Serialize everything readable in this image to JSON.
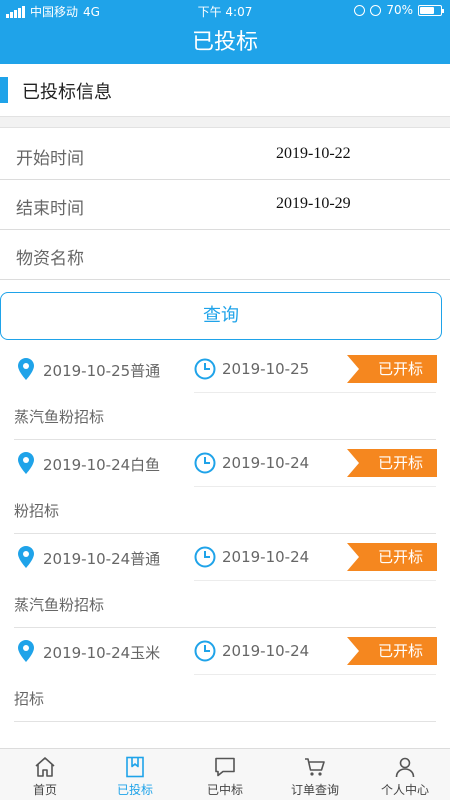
{
  "status_bar": {
    "carrier": "中国移动",
    "network": "4G",
    "time": "下午 4:07",
    "battery": "70%",
    "battery_level": 0.7
  },
  "nav": {
    "title": "已投标"
  },
  "section": {
    "title": "已投标信息"
  },
  "form": {
    "start_label": "开始时间",
    "start_value": "2019-10-22",
    "end_label": "结束时间",
    "end_value": "2019-10-29",
    "material_label": "物资名称",
    "material_value": ""
  },
  "query_button": "查询",
  "bids": [
    {
      "location": "2019-10-25普通",
      "time": "2019-10-25",
      "status": "已开标",
      "name": "蒸汽鱼粉招标"
    },
    {
      "location": "2019-10-24白鱼",
      "time": "2019-10-24",
      "status": "已开标",
      "name": "粉招标"
    },
    {
      "location": "2019-10-24普通",
      "time": "2019-10-24",
      "status": "已开标",
      "name": "蒸汽鱼粉招标"
    },
    {
      "location": "2019-10-24玉米",
      "time": "2019-10-24",
      "status": "已开标",
      "name": "招标"
    }
  ],
  "tabs": [
    {
      "label": "首页",
      "icon": "home-icon",
      "active": false
    },
    {
      "label": "已投标",
      "icon": "bookmark-icon",
      "active": true
    },
    {
      "label": "已中标",
      "icon": "chat-icon",
      "active": false
    },
    {
      "label": "订单查询",
      "icon": "cart-icon",
      "active": false
    },
    {
      "label": "个人中心",
      "icon": "user-icon",
      "active": false
    }
  ],
  "colors": {
    "primary": "#1fa3e9",
    "badge": "#f5871f"
  }
}
